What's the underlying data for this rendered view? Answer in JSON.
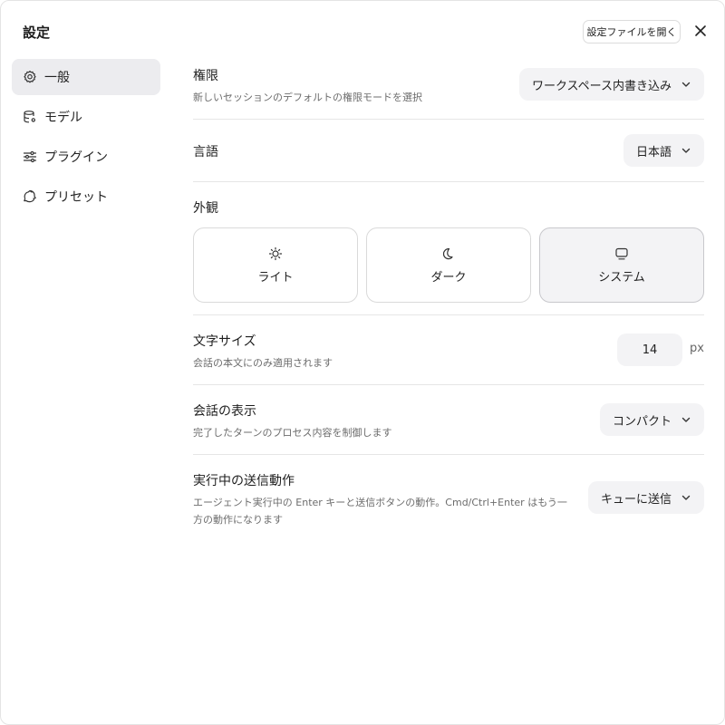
{
  "header": {
    "title": "設定",
    "open_file_label": "設定ファイルを開く"
  },
  "sidebar": {
    "items": [
      {
        "label": "一般",
        "icon": "gear-icon",
        "active": true
      },
      {
        "label": "モデル",
        "icon": "database-icon",
        "active": false
      },
      {
        "label": "プラグイン",
        "icon": "sliders-icon",
        "active": false
      },
      {
        "label": "プリセット",
        "icon": "recycle-icon",
        "active": false
      }
    ]
  },
  "settings": {
    "permission": {
      "title": "権限",
      "desc": "新しいセッションのデフォルトの権限モードを選択",
      "value": "ワークスペース内書き込み"
    },
    "language": {
      "title": "言語",
      "value": "日本語"
    },
    "appearance": {
      "title": "外観",
      "options": [
        {
          "label": "ライト",
          "icon": "sun-icon",
          "selected": false
        },
        {
          "label": "ダーク",
          "icon": "moon-icon",
          "selected": false
        },
        {
          "label": "システム",
          "icon": "monitor-icon",
          "selected": true
        }
      ]
    },
    "font_size": {
      "title": "文字サイズ",
      "desc": "会話の本文にのみ適用されます",
      "value": "14",
      "unit": "px"
    },
    "conversation_display": {
      "title": "会話の表示",
      "desc": "完了したターンのプロセス内容を制御します",
      "value": "コンパクト"
    },
    "send_behavior": {
      "title": "実行中の送信動作",
      "desc_line1": "エージェント実行中の Enter キーと送信ボタンの動作。Cmd/Ctrl+Enter はもう一",
      "desc_line2": "方の動作になります",
      "value": "キューに送信"
    }
  }
}
